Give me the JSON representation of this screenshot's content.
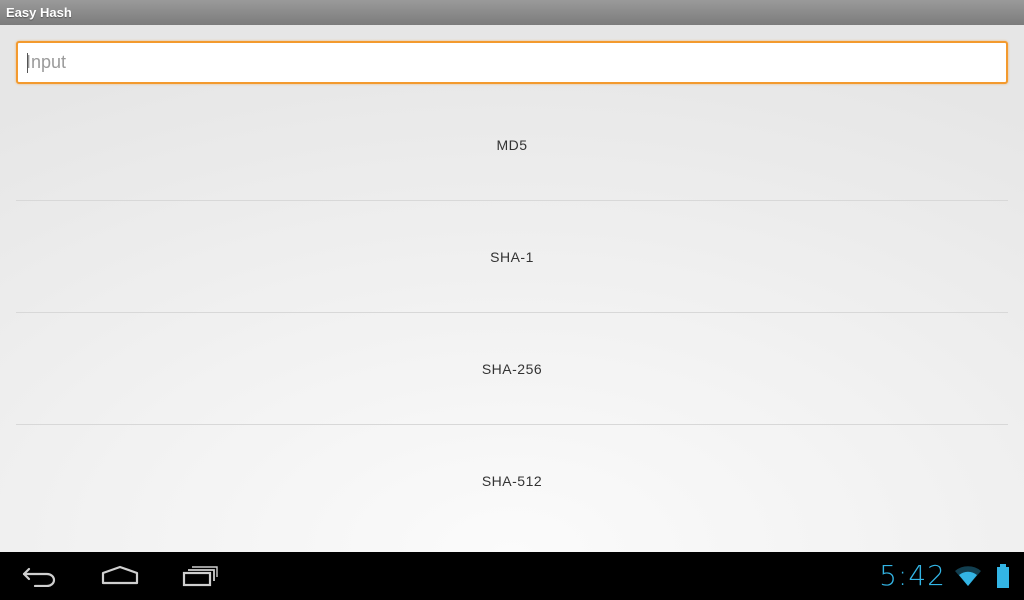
{
  "app": {
    "title": "Easy Hash"
  },
  "input": {
    "placeholder": "Input",
    "value": ""
  },
  "hash_buttons": [
    {
      "label": "MD5"
    },
    {
      "label": "SHA-1"
    },
    {
      "label": "SHA-256"
    },
    {
      "label": "SHA-512"
    }
  ],
  "system_bar": {
    "time": "5:42",
    "accent_color": "#33b5e5",
    "icons": [
      "back-icon",
      "home-icon",
      "recent-apps-icon",
      "wifi-icon",
      "battery-icon"
    ]
  },
  "colors": {
    "input_focus_border": "#f39a2e",
    "titlebar": "#8a8a8a"
  }
}
